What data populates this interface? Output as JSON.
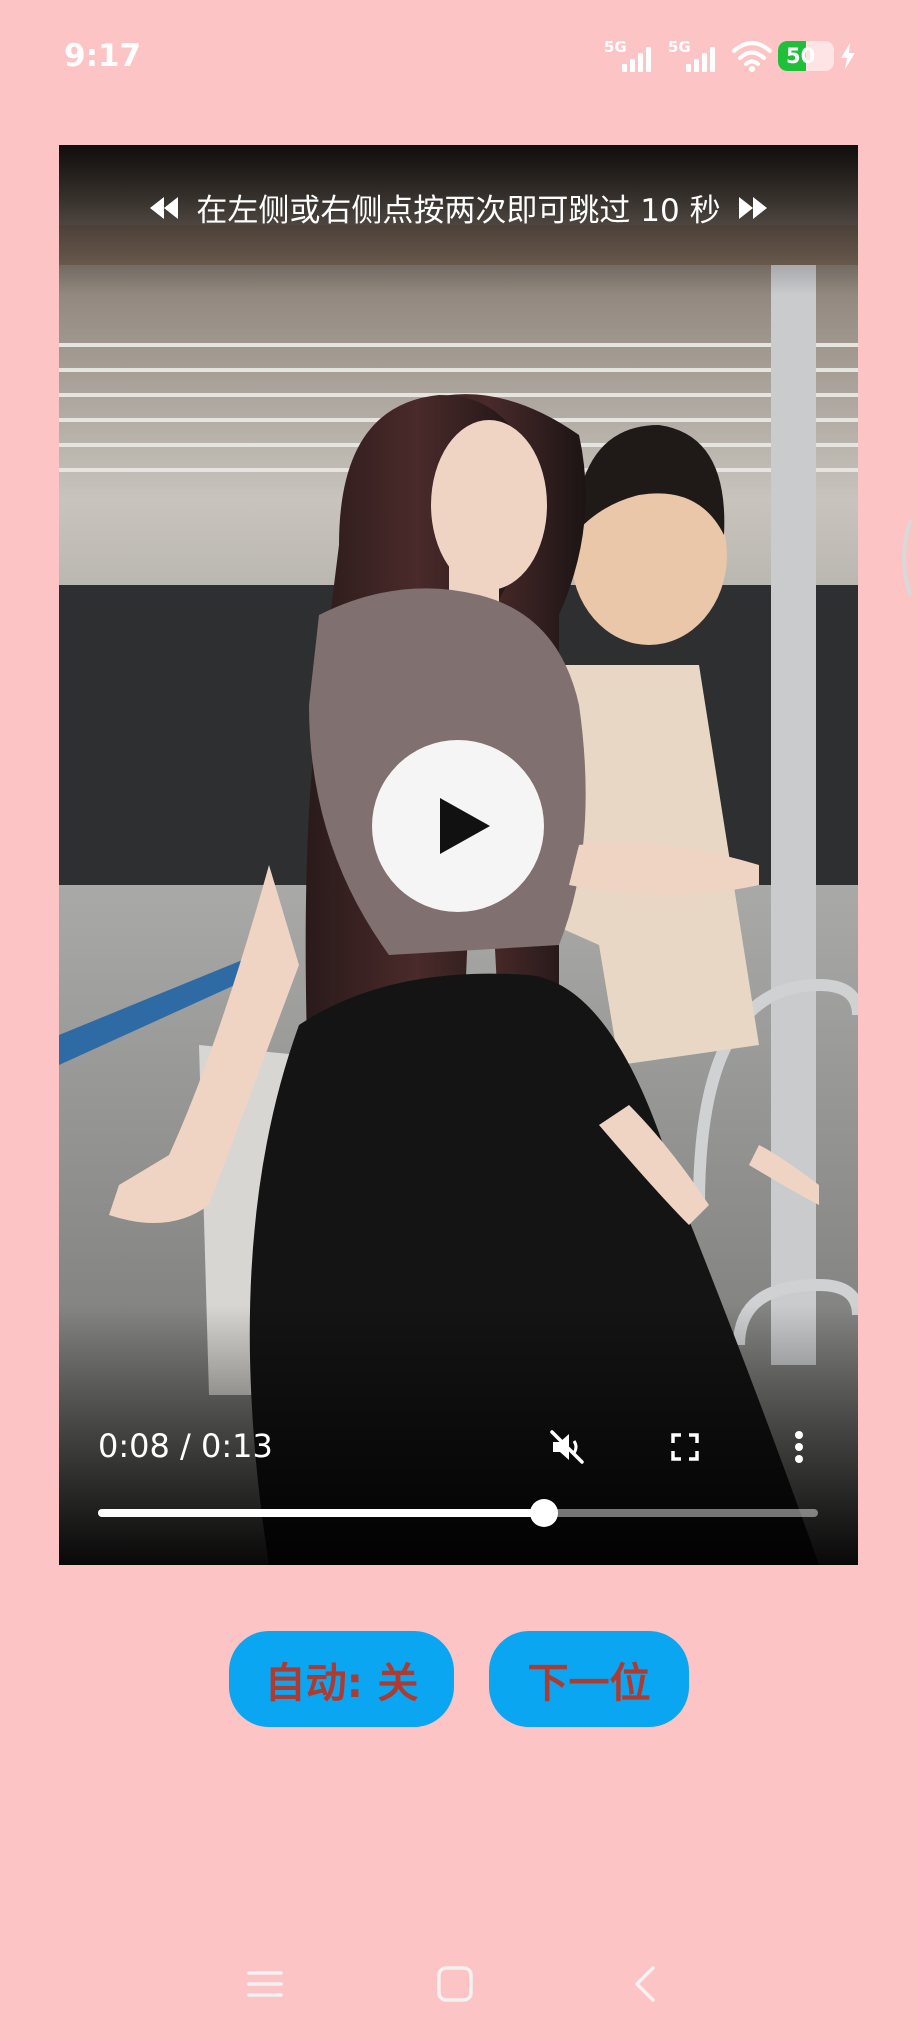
{
  "status_bar": {
    "time": "9:17",
    "signal1_label": "5G",
    "signal2_label": "5G",
    "battery_level": "50",
    "wifi_icon": "wifi-icon",
    "charging_icon": "bolt-icon"
  },
  "video": {
    "skip_hint": "在左侧或右侧点按两次即可跳过 10 秒",
    "current_time": "0:08",
    "separator": " / ",
    "duration": "0:13",
    "progress": 0.62,
    "controls": [
      "muted-speaker-icon",
      "fullscreen-icon",
      "more-vertical-icon"
    ]
  },
  "buttons": {
    "auto_label": "自动: 关",
    "next_label": "下一位"
  },
  "nav_bar": {
    "icons": [
      "menu-icon",
      "home-square-icon",
      "back-chevron-icon"
    ]
  },
  "colors": {
    "background": "#fdc4c6",
    "button_bg": "#0aa6f2",
    "button_text": "#b03a2e",
    "battery_green": "#1fbf3a"
  }
}
